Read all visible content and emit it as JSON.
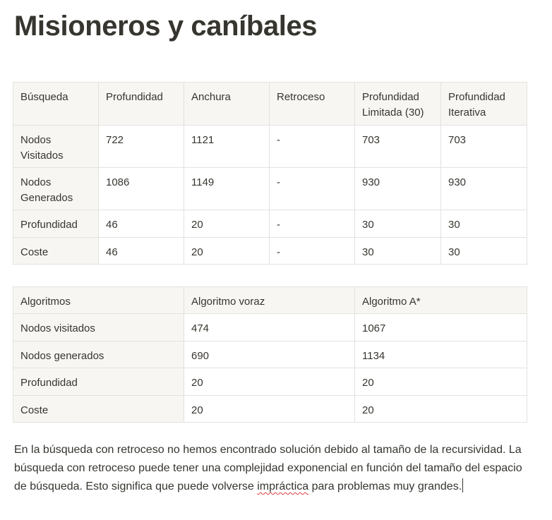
{
  "title": "Misioneros y caníbales",
  "table_uninformed": {
    "headers": [
      "Búsqueda",
      "Profundidad",
      "Anchura",
      "Retroceso",
      "Profundidad Limitada (30)",
      "Profundidad Iterativa"
    ],
    "rows": [
      [
        "Nodos Visitados",
        "722",
        "1121",
        "-",
        "703",
        "703"
      ],
      [
        "Nodos Generados",
        "1086",
        "1149",
        "-",
        "930",
        "930"
      ],
      [
        "Profundidad",
        "46",
        "20",
        "-",
        "30",
        "30"
      ],
      [
        "Coste",
        "46",
        "20",
        "-",
        "30",
        "30"
      ]
    ]
  },
  "table_informed": {
    "headers": [
      "Algoritmos",
      "Algoritmo voraz",
      "Algoritmo A*"
    ],
    "rows": [
      [
        "Nodos visitados",
        "474",
        "1067"
      ],
      [
        "Nodos generados",
        "690",
        "1134"
      ],
      [
        "Profundidad",
        "20",
        "20"
      ],
      [
        "Coste",
        "20",
        "20"
      ]
    ]
  },
  "paragraph": {
    "before": "En la búsqueda con retroceso no hemos encontrado solución debido al tamaño de la recursividad. La búsqueda con retroceso puede tener una complejidad exponencial en función del tamaño del espacio de búsqueda. Esto significa que puede volverse ",
    "misspelled": "impráctica",
    "after": " para problemas muy grandes."
  }
}
